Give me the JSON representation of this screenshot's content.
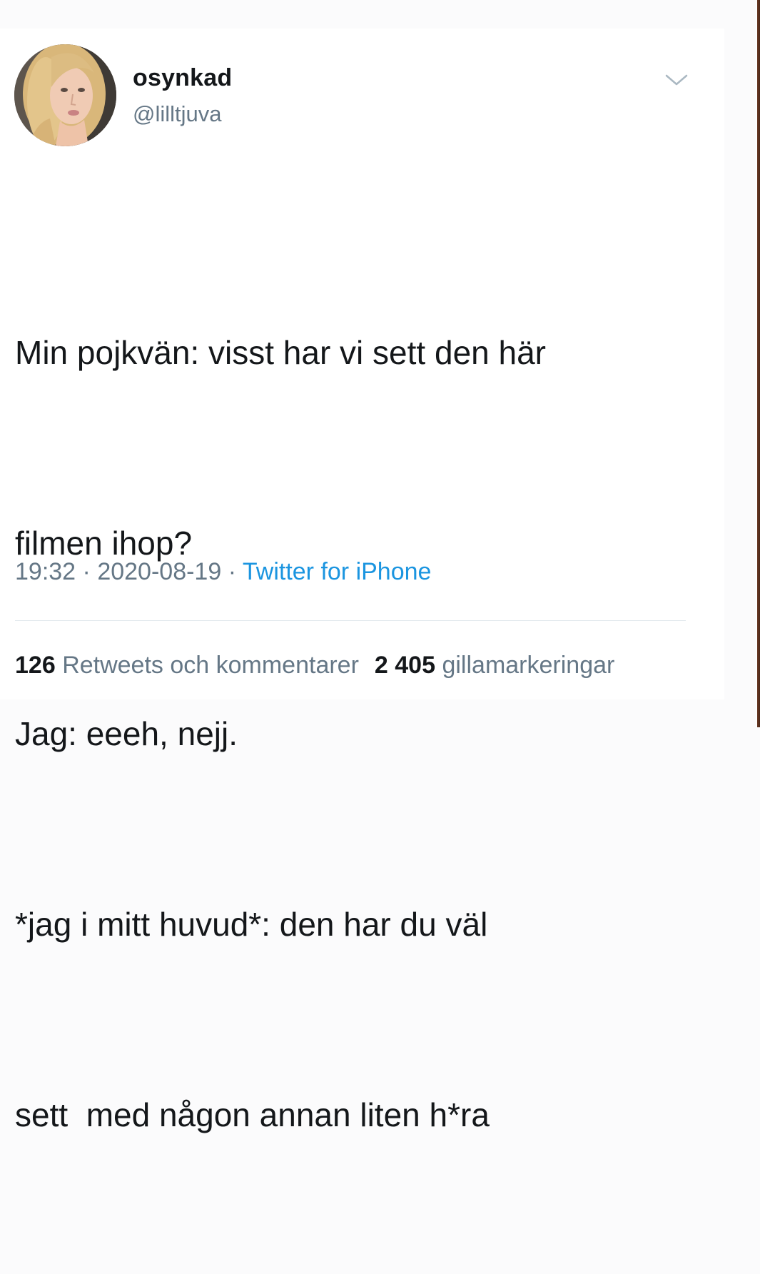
{
  "tweet": {
    "display_name": "osynkad",
    "handle": "@lilltjuva",
    "text_lines": [
      "Min pojkvän: visst har vi sett den här",
      "filmen ihop?",
      "Jag: eeeh, nejj.",
      "*jag i mitt huvud*: den har du väl",
      "sett  med någon annan liten h*ra"
    ],
    "time": "19:32",
    "date": "2020-08-19",
    "separator": "·",
    "source": "Twitter for iPhone"
  },
  "stats": {
    "retweets_count": "126",
    "retweets_label": "Retweets och kommentarer",
    "likes_count": "2 405",
    "likes_label": "gillamarkeringar"
  },
  "icons": {
    "menu": "chevron-down-icon"
  },
  "colors": {
    "text": "#14171a",
    "secondary": "#657786",
    "link": "#1b95e0",
    "divider": "#e1e8ed"
  }
}
